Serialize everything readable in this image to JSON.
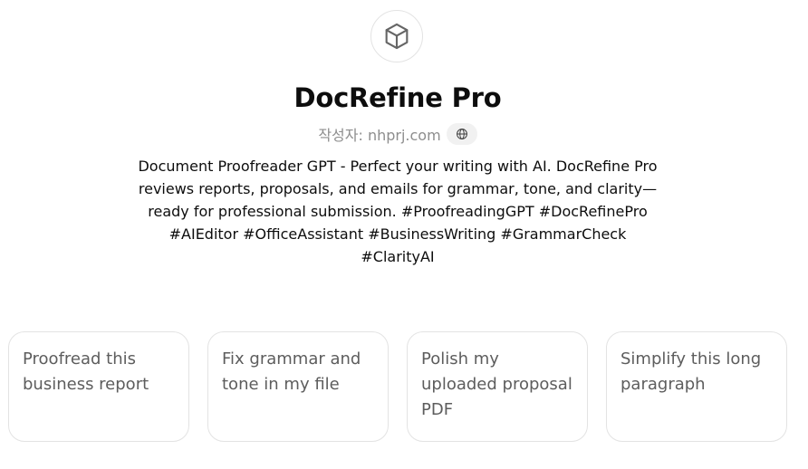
{
  "gpt": {
    "icon": "cube-icon",
    "name": "DocRefine Pro",
    "author_label": "작성자: nhprj.com",
    "website_icon": "globe-icon",
    "description": "Document Proofreader GPT - Perfect your writing with AI. DocRefine Pro reviews reports, proposals, and emails for grammar, tone, and clarity—ready for professional submission. #ProofreadingGPT #DocRefinePro #AIEditor #OfficeAssistant #BusinessWriting #GrammarCheck #ClarityAI"
  },
  "conversation_starters": [
    "Proofread this business report",
    "Fix grammar and tone in my file",
    "Polish my uploaded proposal PDF",
    "Simplify this long paragraph"
  ],
  "colors": {
    "text": "#0d0d0d",
    "muted": "#8e8e8e",
    "border": "#e3e3e3"
  }
}
